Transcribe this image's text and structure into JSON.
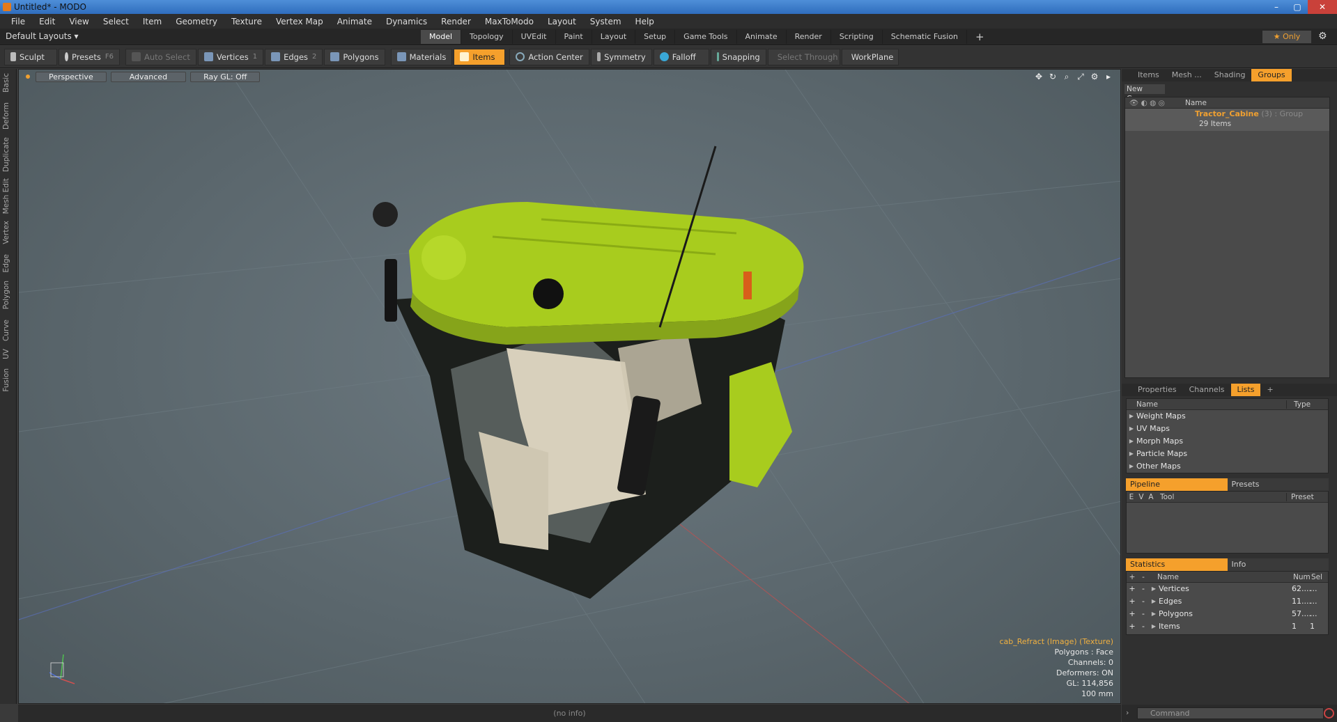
{
  "window": {
    "title": "Untitled* - MODO",
    "min": "–",
    "max": "▢",
    "close": "✕"
  },
  "menu": [
    "File",
    "Edit",
    "View",
    "Select",
    "Item",
    "Geometry",
    "Texture",
    "Vertex Map",
    "Animate",
    "Dynamics",
    "Render",
    "MaxToModo",
    "Layout",
    "System",
    "Help"
  ],
  "layouts": {
    "label": "Default Layouts ▾"
  },
  "tabs": {
    "items": [
      "Model",
      "Topology",
      "UVEdit",
      "Paint",
      "Layout",
      "Setup",
      "Game Tools",
      "Animate",
      "Render",
      "Scripting",
      "Schematic Fusion"
    ],
    "active": "Model",
    "plus": "+"
  },
  "only": {
    "label": "★  Only"
  },
  "toolbar": {
    "sculpt": "Sculpt",
    "presets": "Presets",
    "presets_key": "F6",
    "auto_select": "Auto Select",
    "vertices": "Vertices",
    "vertices_key": "1",
    "edges": "Edges",
    "edges_key": "2",
    "polygons": "Polygons",
    "materials": "Materials",
    "items": "Items",
    "action_center": "Action Center",
    "symmetry": "Symmetry",
    "falloff": "Falloff",
    "snapping": "Snapping",
    "select_through": "Select Through",
    "workplane": "WorkPlane"
  },
  "left_tabs": [
    "Basic",
    "Deform",
    "Duplicate",
    "Mesh Edit",
    "Vertex",
    "Edge",
    "Polygon",
    "Curve",
    "UV",
    "Fusion"
  ],
  "viewport": {
    "view": "Perspective",
    "advanced": "Advanced",
    "raygl": "Ray GL: Off",
    "info": {
      "texture": "cab_Refract (Image) (Texture)",
      "polygons": "Polygons : Face",
      "channels": "Channels: 0",
      "deformers": "Deformers: ON",
      "gl": "GL: 114,856",
      "scale": "100 mm"
    }
  },
  "status": {
    "text": "(no info)"
  },
  "top_panel": {
    "tabs": [
      "Items",
      "Mesh ...",
      "Shading",
      "Groups"
    ],
    "active": "Groups",
    "new_group": "New Group",
    "col_name": "Name",
    "group_name": "Tractor_Cabine",
    "group_suffix": "(3) : Group",
    "group_count": "29 Items"
  },
  "lists_panel": {
    "tabs": [
      "Properties",
      "Channels",
      "Lists"
    ],
    "active": "Lists",
    "plus": "+",
    "col_name": "Name",
    "col_type": "Type",
    "items": [
      "Weight Maps",
      "UV Maps",
      "Morph Maps",
      "Particle Maps",
      "Other Maps"
    ]
  },
  "pipeline": {
    "tab_pipeline": "Pipeline",
    "tab_presets": "Presets",
    "col_e": "E",
    "col_v": "V",
    "col_a": "A",
    "col_tool": "Tool",
    "col_preset": "Preset"
  },
  "statistics": {
    "tab_statistics": "Statistics",
    "tab_info": "Info",
    "col_plus": "+",
    "col_minus": "-",
    "col_name": "Name",
    "col_num": "Num",
    "col_sel": "Sel",
    "rows": [
      {
        "name": "Vertices",
        "num": "62....",
        "sel": "..."
      },
      {
        "name": "Edges",
        "num": "11....",
        "sel": "..."
      },
      {
        "name": "Polygons",
        "num": "57....",
        "sel": "..."
      },
      {
        "name": "Items",
        "num": "1",
        "sel": "1"
      }
    ]
  },
  "command": {
    "placeholder": "Command"
  },
  "colors": {
    "accent": "#f5a02c",
    "cabin": "#a8cc1e",
    "seat": "#d8d0bc"
  }
}
